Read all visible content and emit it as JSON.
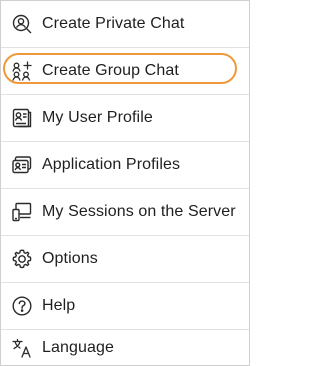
{
  "menu": {
    "items": [
      {
        "id": "create-private-chat",
        "label": "Create Private Chat",
        "icon": "person-search-icon"
      },
      {
        "id": "create-group-chat",
        "label": "Create Group Chat",
        "icon": "group-add-icon",
        "highlighted": true
      },
      {
        "id": "my-user-profile",
        "label": "My User Profile",
        "icon": "profile-card-icon"
      },
      {
        "id": "application-profiles",
        "label": "Application Profiles",
        "icon": "id-card-icon"
      },
      {
        "id": "my-sessions",
        "label": "My Sessions on the Server",
        "icon": "devices-icon"
      },
      {
        "id": "options",
        "label": "Options",
        "icon": "gear-icon"
      },
      {
        "id": "help",
        "label": "Help",
        "icon": "help-icon"
      },
      {
        "id": "language",
        "label": "Language",
        "icon": "translate-icon"
      }
    ],
    "highlight_color": "#ef9a3a",
    "text_color": "#1f1f1f"
  }
}
